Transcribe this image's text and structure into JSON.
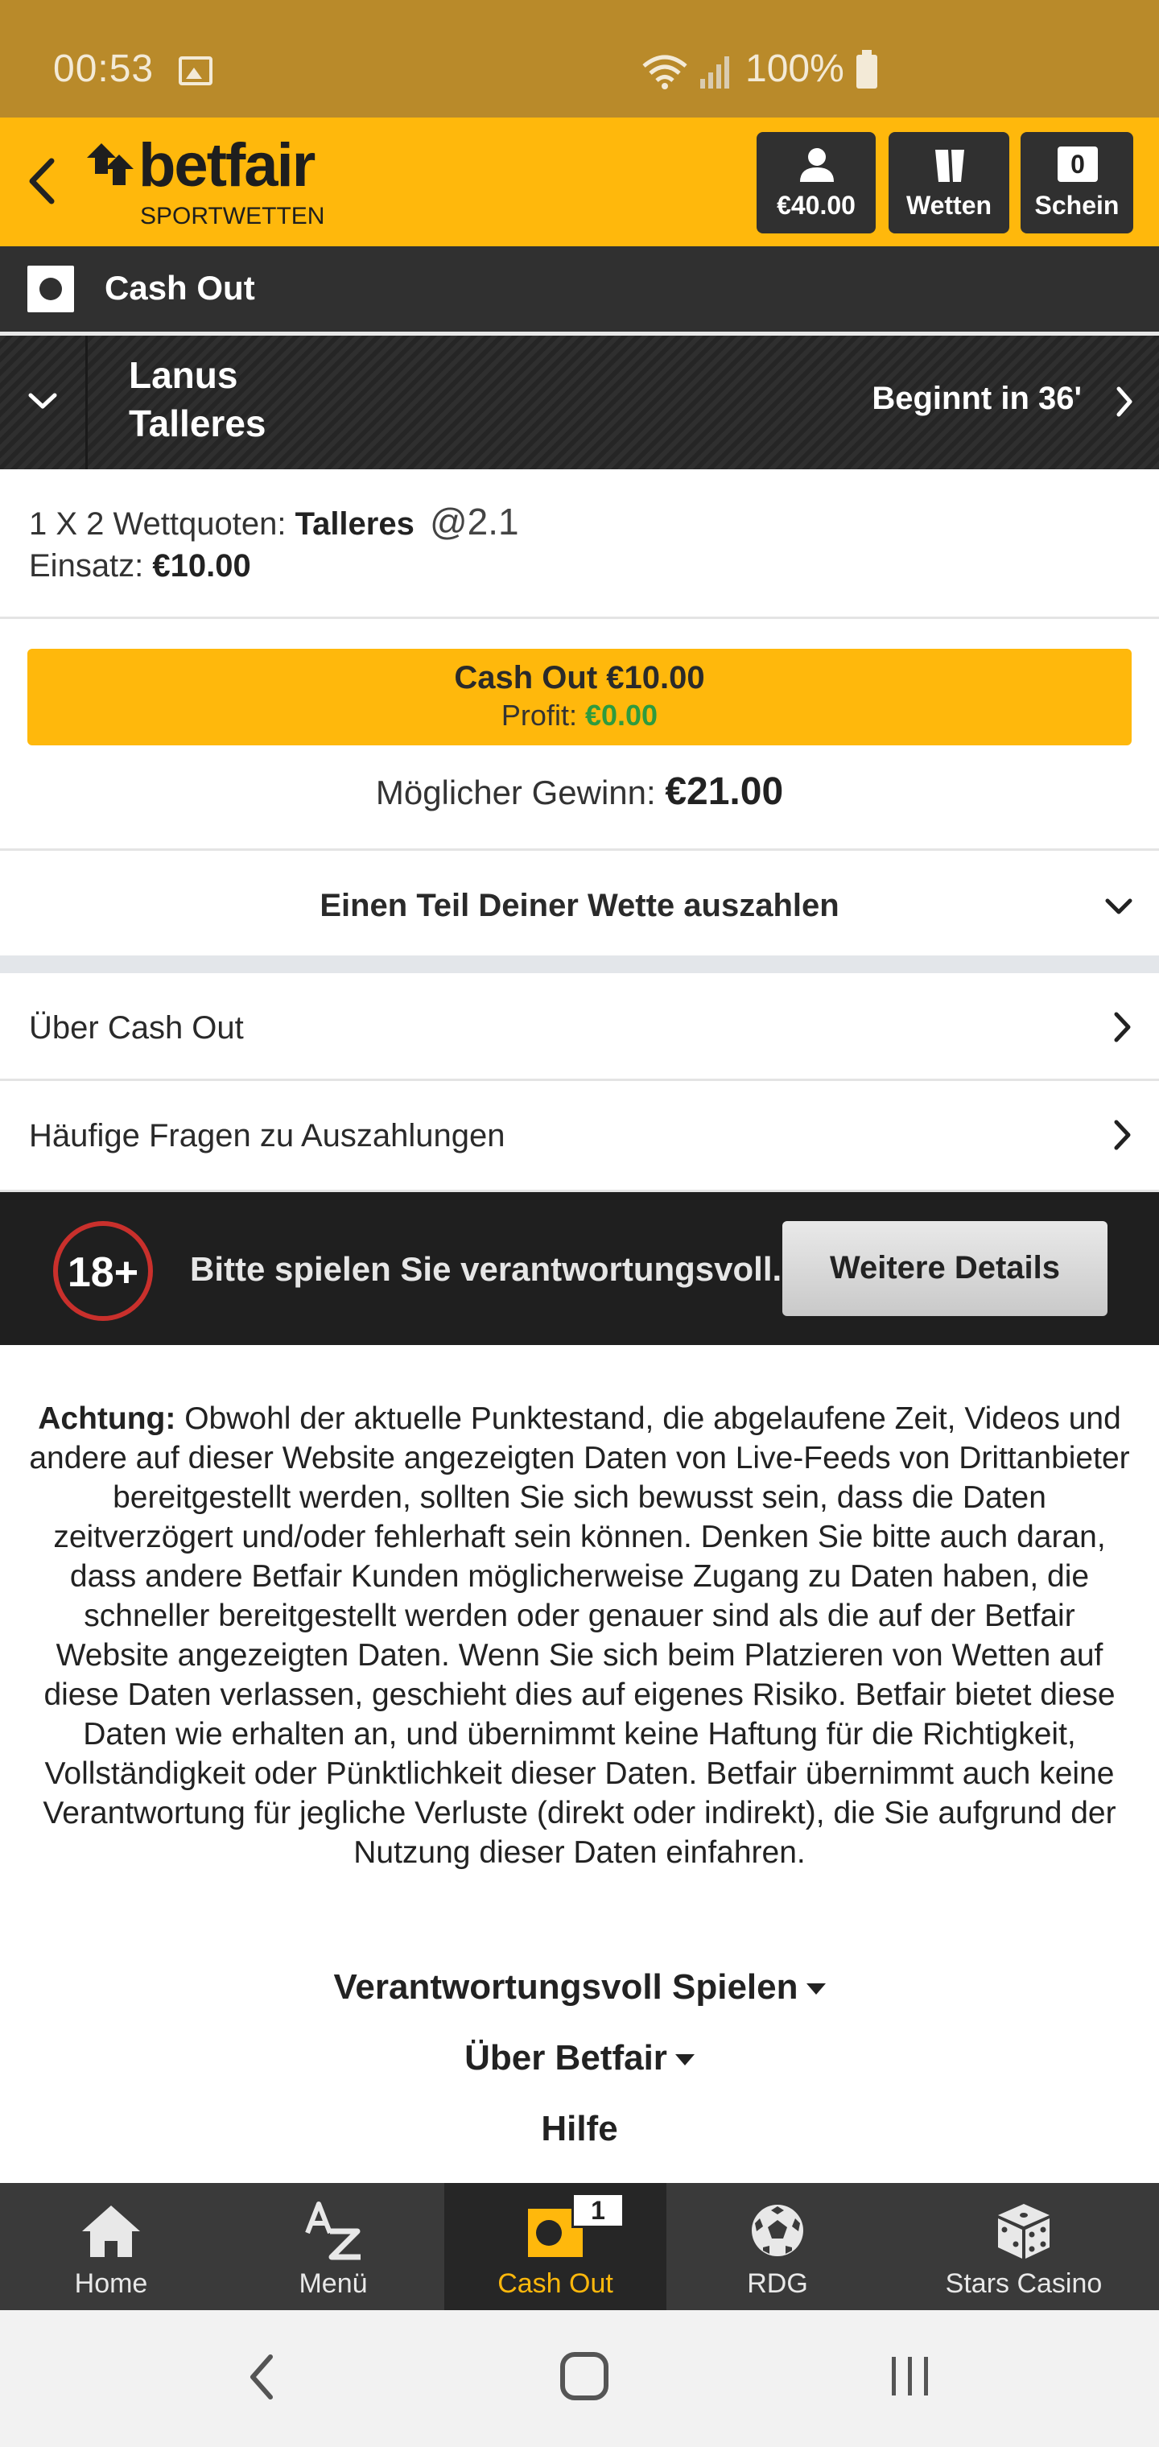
{
  "status_bar": {
    "time": "00:53",
    "battery": "100%"
  },
  "header": {
    "brand": "betfair",
    "brand_sub": "SPORTWETTEN",
    "account_label": "€40.00",
    "bets_label": "Wetten",
    "slip_count": "0",
    "slip_label": "Schein"
  },
  "titlebar": {
    "title": "Cash Out"
  },
  "event": {
    "home": "Lanus",
    "away": "Talleres",
    "starts": "Beginnt in 36'"
  },
  "bet": {
    "market": "1 X 2 Wettquoten:",
    "selection": "Talleres",
    "odds": "@2.1",
    "stake_label": "Einsatz:",
    "stake_value": "€10.00"
  },
  "cashout": {
    "button_label": "Cash Out €10.00",
    "profit_label": "Profit:",
    "profit_value": "€0.00",
    "potential_label": "Möglicher Gewinn:",
    "potential_value": "€21.00",
    "partial_label": "Einen Teil Deiner Wette auszahlen"
  },
  "links": {
    "about": "Über Cash Out",
    "faq": "Häufige Fragen zu Auszahlungen"
  },
  "responsible": {
    "age": "18+",
    "message": "Bitte spielen Sie verantwortungsvoll.",
    "button": "Weitere Details"
  },
  "disclaimer": {
    "bold": "Achtung:",
    "text": "Obwohl der aktuelle Punktestand, die abgelaufene Zeit, Videos und andere auf dieser Website angezeigten Daten von Live-Feeds von Drittanbieter bereitgestellt werden, sollten Sie sich bewusst sein, dass die Daten zeitverzögert und/oder fehlerhaft sein können.  Denken Sie bitte auch daran, dass andere Betfair Kunden möglicherweise Zugang zu Daten haben, die schneller bereitgestellt werden oder genauer sind als die auf der Betfair Website angezeigten Daten. Wenn Sie sich beim Platzieren von Wetten auf diese Daten verlassen, geschieht dies auf eigenes Risiko. Betfair bietet diese Daten wie erhalten an, und übernimmt keine Haftung für die Richtigkeit, Vollständigkeit oder Pünktlichkeit dieser Daten. Betfair übernimmt auch keine Verantwortung für jegliche Verluste (direkt oder indirekt), die Sie aufgrund der Nutzung dieser Daten einfahren."
  },
  "footer": {
    "responsible": "Verantwortungsvoll Spielen",
    "about": "Über Betfair",
    "help": "Hilfe"
  },
  "bottom_nav": {
    "home": "Home",
    "menu": "Menü",
    "cashout": "Cash Out",
    "cashout_badge": "1",
    "rdg": "RDG",
    "casino": "Stars Casino"
  },
  "colors": {
    "brand_yellow": "#ffb80c",
    "dark": "#303030",
    "profit_green": "#2e9b3e",
    "status_bar": "#b98a2a"
  }
}
